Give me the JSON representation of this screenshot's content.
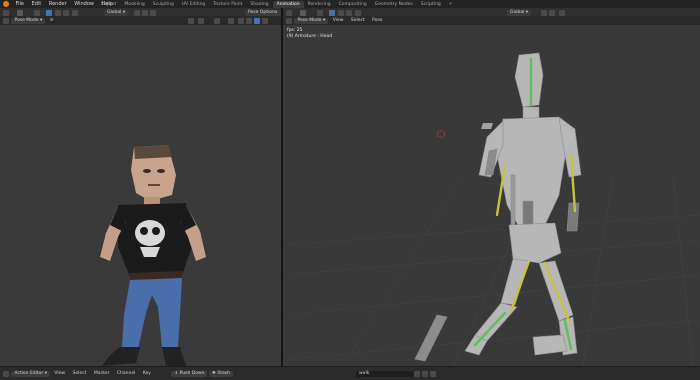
{
  "menubar": {
    "items": [
      "File",
      "Edit",
      "Render",
      "Window",
      "Help"
    ],
    "tabs": [
      "Layout",
      "Modeling",
      "Sculpting",
      "UV Editing",
      "Texture Paint",
      "Shading",
      "Animation",
      "Rendering",
      "Compositing",
      "Geometry Nodes",
      "Scripting"
    ],
    "active_tab": "Animation",
    "add_tab": "+"
  },
  "left_viewport": {
    "mode": "Pose Mode",
    "orientation": "Global",
    "pose_options": "Pose Options"
  },
  "right_viewport": {
    "mode": "Pose Mode",
    "menus": [
      "View",
      "Select",
      "Pose"
    ],
    "orientation": "Global",
    "overlay_fps": "fps: 25",
    "overlay_object": "(9) Armature : Head"
  },
  "bottom_bar": {
    "editor": "Action Editor",
    "menus": [
      "View",
      "Select",
      "Marker",
      "Channel",
      "Key"
    ],
    "push_down": "Push Down",
    "stash": "Stash",
    "action_name": "walk"
  },
  "colors": {
    "accent_orange": "#e87d0d",
    "selected_blue": "#4772b3",
    "bone_yellow": "#c8c040",
    "bone_green": "#5fbf5a"
  }
}
